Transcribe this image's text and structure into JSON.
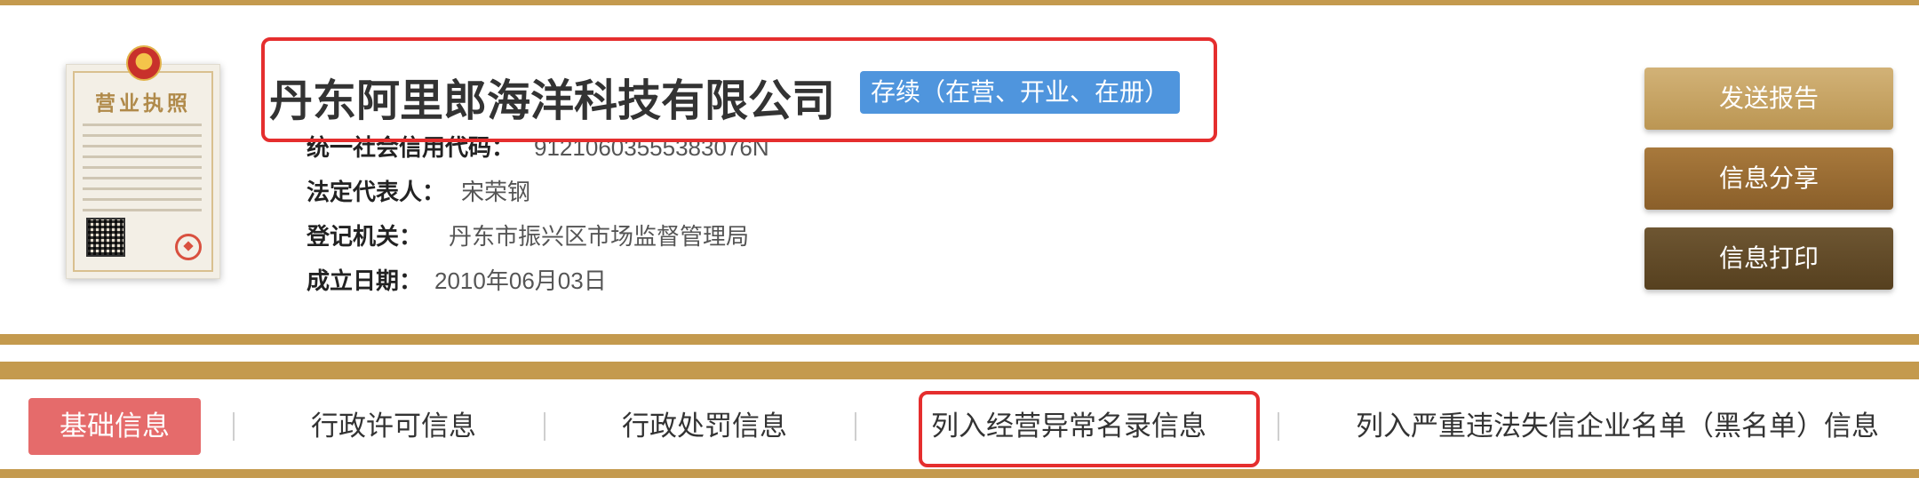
{
  "license": {
    "title": "营业执照",
    "icon": "business-license-image"
  },
  "company": {
    "name": "丹东阿里郎海洋科技有限公司",
    "status": "存续（在营、开业、在册）",
    "credit_code_label": "统一社会信用代码：",
    "credit_code": "91210603555383076N",
    "legal_rep_label": "法定代表人：",
    "legal_rep": "宋荣钢",
    "reg_authority_label": "登记机关：",
    "reg_authority": "丹东市振兴区市场监督管理局",
    "founded_label": "成立日期：",
    "founded": "2010年06月03日"
  },
  "actions": {
    "send_report": "发送报告",
    "share_info": "信息分享",
    "print_info": "信息打印"
  },
  "tabs": [
    {
      "label": "基础信息",
      "active": true
    },
    {
      "label": "行政许可信息"
    },
    {
      "label": "行政处罚信息"
    },
    {
      "label": "列入经营异常名录信息"
    },
    {
      "label": "列入严重违法失信企业名单（黑名单）信息"
    }
  ],
  "colors": {
    "gold": "#c49a4e",
    "status_blue": "#4f95dd",
    "active_tab": "#e56b6b",
    "highlight_red": "#e52e2e"
  }
}
